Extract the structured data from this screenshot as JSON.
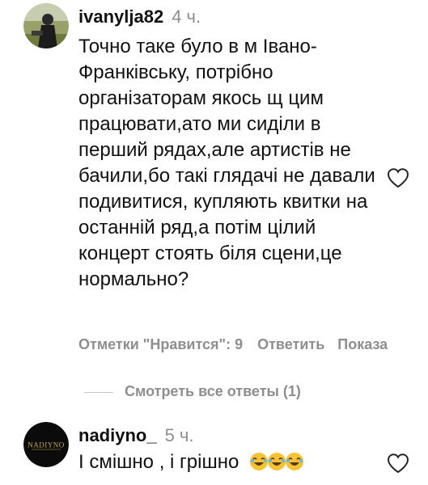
{
  "comments": [
    {
      "username": "ivanylja82",
      "time": "4 ч.",
      "text": "Точно таке було в м Івано-Франківську, потрібно організаторам якось щ цим працювати,ато ми сиділи в перший рядах,але артистів не бачили,бо такі глядачі не давали подивитися, купляють квитки на останній ряд,а потім цілий концерт стоять біля сцени,це нормально?",
      "icon": "heart-outline-icon"
    },
    {
      "username": "nadiyno_",
      "time": "5 ч.",
      "text": "І смішно , і грішно",
      "emoji": "😂😂😂",
      "avatar_text": "NADIYNO",
      "icon": "heart-outline-icon"
    }
  ],
  "actions": {
    "likes": "Отметки \"Нравится\": 9",
    "reply": "Ответить",
    "more": "Показа"
  },
  "view_replies": "Смотреть все ответы (1)",
  "colors": {
    "text": "#111111",
    "muted": "#8e8e8e",
    "divider": "#c7c7c7",
    "avatar_gold": "#c9a84e"
  }
}
